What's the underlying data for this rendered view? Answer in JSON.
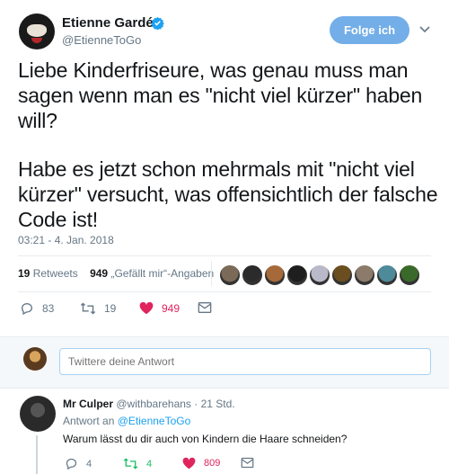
{
  "tweet": {
    "author_name": "Etienne Gardé",
    "author_handle": "@EtienneToGo",
    "follow_label": "Folge ich",
    "text_p1": "Liebe Kinderfriseure, was genau muss man sagen wenn man es \"nicht viel kürzer\" haben will?",
    "text_p2": "Habe es jetzt schon mehrmals mit \"nicht viel kürzer\" versucht, was offensichtlich der falsche Code ist!",
    "timestamp": "03:21 - 4. Jan. 2018",
    "retweets_count": "19",
    "retweets_label": "Retweets",
    "likes_count": "949",
    "likes_label": "„Gefällt mir“-Angaben",
    "actions": {
      "replies": "83",
      "retweets": "19",
      "likes": "949"
    }
  },
  "liker_avatars": [
    "#7b6a58",
    "#2b2b2b",
    "#a66a3a",
    "#1e1e1e",
    "#b9b9c9",
    "#6b4e1f",
    "#8c7b6a",
    "#4e8a9a",
    "#3a6a2a"
  ],
  "reply_box": {
    "placeholder": "Twittere deine Antwort"
  },
  "reply": {
    "author_name": "Mr Culper",
    "author_handle": "@withbarehans",
    "time": "· 21 Std.",
    "reply_to_prefix": "Antwort an",
    "reply_to_handle": "@EtienneToGo",
    "text": "Warum lässt du dir auch von Kindern die Haare schneiden?",
    "actions": {
      "replies": "4",
      "retweets": "4",
      "likes": "809"
    }
  },
  "colors": {
    "accent": "#1da1f2",
    "follow_button": "#73aee8",
    "like": "#e0245e",
    "retweet": "#17bf63",
    "muted": "#657786"
  },
  "icons": [
    "verified-icon",
    "caret-down-icon",
    "reply-icon",
    "retweet-icon",
    "heart-icon",
    "mail-icon"
  ]
}
